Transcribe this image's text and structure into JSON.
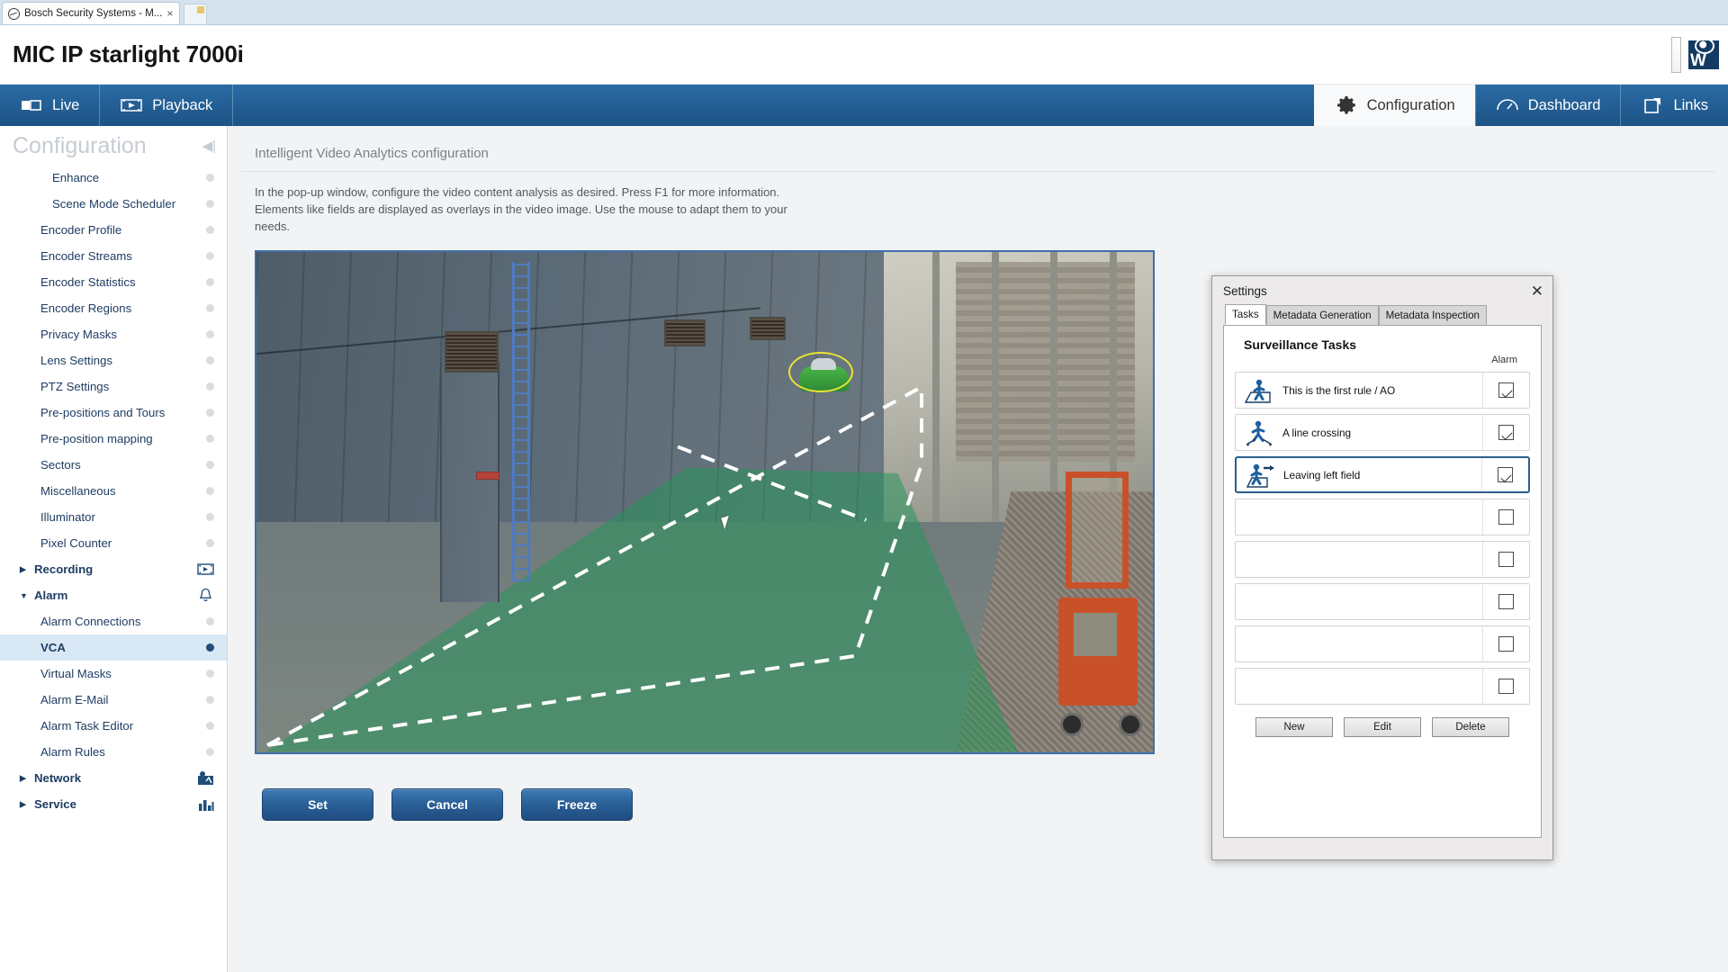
{
  "browser": {
    "tab_title": "Bosch Security Systems - M...",
    "tab_close": "×"
  },
  "header": {
    "device_title": "MIC IP starlight 7000i"
  },
  "navbar": {
    "left_items": [
      {
        "label": "Live",
        "icon": "live-camera-icon",
        "active": false
      },
      {
        "label": "Playback",
        "icon": "playback-icon",
        "active": false
      }
    ],
    "right_items": [
      {
        "label": "Configuration",
        "icon": "gear-icon",
        "active": true
      },
      {
        "label": "Dashboard",
        "icon": "dashboard-icon",
        "active": false
      },
      {
        "label": "Links",
        "icon": "external-link-icon",
        "active": false
      }
    ]
  },
  "sidebar": {
    "title": "Configuration",
    "collapse_icon": "collapse-panel-icon",
    "items": [
      {
        "label": "Enhance",
        "level": 2,
        "marker": "dot",
        "selected": false
      },
      {
        "label": "Scene Mode Scheduler",
        "level": 2,
        "marker": "dot",
        "selected": false
      },
      {
        "label": "Encoder Profile",
        "level": 1,
        "marker": "dot",
        "selected": false
      },
      {
        "label": "Encoder Streams",
        "level": 1,
        "marker": "dot",
        "selected": false
      },
      {
        "label": "Encoder Statistics",
        "level": 1,
        "marker": "dot",
        "selected": false
      },
      {
        "label": "Encoder Regions",
        "level": 1,
        "marker": "dot",
        "selected": false
      },
      {
        "label": "Privacy Masks",
        "level": 1,
        "marker": "dot",
        "selected": false
      },
      {
        "label": "Lens Settings",
        "level": 1,
        "marker": "dot",
        "selected": false
      },
      {
        "label": "PTZ Settings",
        "level": 1,
        "marker": "dot",
        "selected": false
      },
      {
        "label": "Pre-positions and Tours",
        "level": 1,
        "marker": "dot",
        "selected": false
      },
      {
        "label": "Pre-position mapping",
        "level": 1,
        "marker": "dot",
        "selected": false
      },
      {
        "label": "Sectors",
        "level": 1,
        "marker": "dot",
        "selected": false
      },
      {
        "label": "Miscellaneous",
        "level": 1,
        "marker": "dot",
        "selected": false
      },
      {
        "label": "Illuminator",
        "level": 1,
        "marker": "dot",
        "selected": false
      },
      {
        "label": "Pixel Counter",
        "level": 1,
        "marker": "dot",
        "selected": false
      },
      {
        "label": "Recording",
        "level": 0,
        "expanded": false,
        "marker": "recording-icon",
        "selected": false
      },
      {
        "label": "Alarm",
        "level": 0,
        "expanded": true,
        "marker": "bell-icon",
        "selected": false
      },
      {
        "label": "Alarm Connections",
        "level": 1,
        "marker": "dot",
        "selected": false
      },
      {
        "label": "VCA",
        "level": 1,
        "marker": "dot-active",
        "selected": true
      },
      {
        "label": "Virtual Masks",
        "level": 1,
        "marker": "dot",
        "selected": false
      },
      {
        "label": "Alarm E-Mail",
        "level": 1,
        "marker": "dot",
        "selected": false
      },
      {
        "label": "Alarm Task Editor",
        "level": 1,
        "marker": "dot",
        "selected": false
      },
      {
        "label": "Alarm Rules",
        "level": 1,
        "marker": "dot",
        "selected": false
      },
      {
        "label": "Network",
        "level": 0,
        "expanded": false,
        "marker": "network-icon",
        "selected": false
      },
      {
        "label": "Service",
        "level": 0,
        "expanded": false,
        "marker": "stats-icon",
        "selected": false
      }
    ]
  },
  "main": {
    "panel_title": "Intelligent Video Analytics configuration",
    "description": "In the pop-up window, configure the video content analysis as desired. Press F1 for more information. Elements like fields are displayed as overlays in the video image. Use the mouse to adapt them to your needs.",
    "buttons": [
      {
        "label": "Set"
      },
      {
        "label": "Cancel"
      },
      {
        "label": "Freeze"
      }
    ]
  },
  "dialog": {
    "title": "Settings",
    "close_label": "✕",
    "tabs": [
      {
        "label": "Tasks",
        "active": true
      },
      {
        "label": "Metadata Generation",
        "active": false
      },
      {
        "label": "Metadata Inspection",
        "active": false
      }
    ],
    "section_title": "Surveillance Tasks",
    "alarm_column_label": "Alarm",
    "tasks": [
      {
        "label": "This is the first rule / AO",
        "icon": "person-in-field-icon",
        "checked": true,
        "selected": false
      },
      {
        "label": "A line crossing",
        "icon": "person-line-crossing-icon",
        "checked": true,
        "selected": false
      },
      {
        "label": "Leaving left field",
        "icon": "person-leaving-field-icon",
        "checked": true,
        "selected": true
      },
      {
        "label": "",
        "icon": "",
        "checked": false,
        "selected": false
      },
      {
        "label": "",
        "icon": "",
        "checked": false,
        "selected": false
      },
      {
        "label": "",
        "icon": "",
        "checked": false,
        "selected": false
      },
      {
        "label": "",
        "icon": "",
        "checked": false,
        "selected": false
      },
      {
        "label": "",
        "icon": "",
        "checked": false,
        "selected": false
      }
    ],
    "buttons": [
      {
        "label": "New"
      },
      {
        "label": "Edit"
      },
      {
        "label": "Delete"
      }
    ]
  },
  "colors": {
    "nav_blue": "#1d5385",
    "accent_blue": "#2b5f8d",
    "sidebar_selected": "#d9e8f5",
    "detect_yellow": "#e9e432",
    "field_green": "#24965a"
  }
}
